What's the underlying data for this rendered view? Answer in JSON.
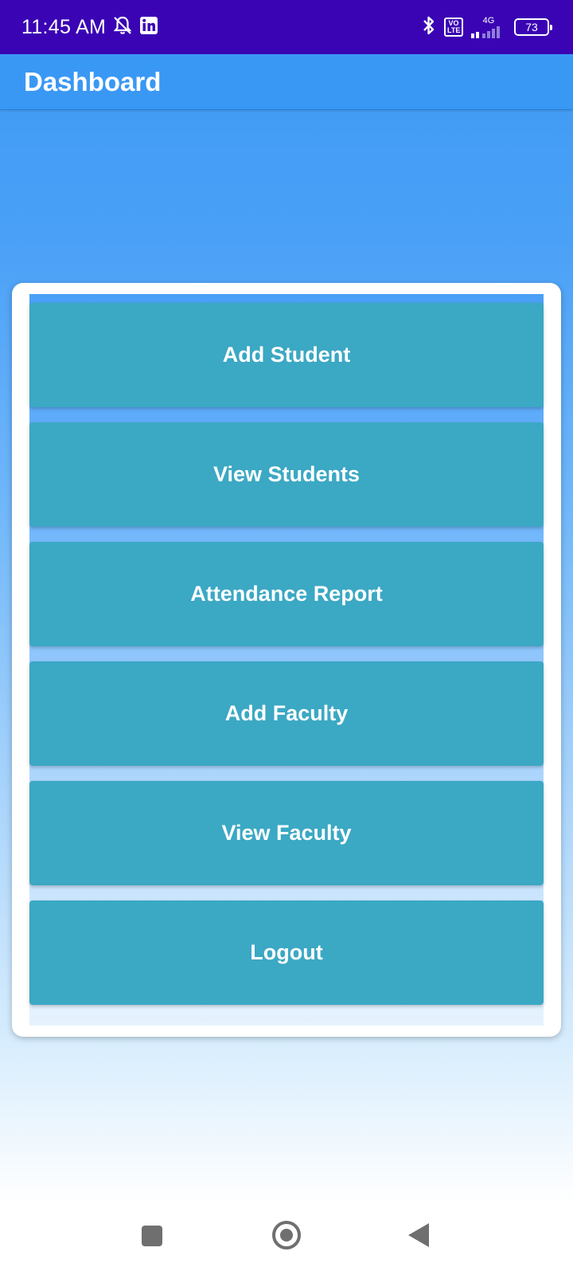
{
  "status_bar": {
    "time": "11:45 AM",
    "icons": [
      "notifications-off-icon",
      "linkedin-icon",
      "bluetooth-icon",
      "volte-icon",
      "signal-4g-icon",
      "battery-icon"
    ],
    "volte_label": "Vo\nLTE",
    "network": "4G",
    "battery": "73"
  },
  "app_bar": {
    "title": "Dashboard"
  },
  "menu": {
    "buttons": [
      {
        "label": "Add Student"
      },
      {
        "label": "View Students"
      },
      {
        "label": "Attendance Report"
      },
      {
        "label": "Add Faculty"
      },
      {
        "label": "View Faculty"
      },
      {
        "label": "Logout"
      }
    ]
  },
  "nav_bar": {
    "icons": [
      "recents-icon",
      "home-icon",
      "back-icon"
    ]
  },
  "colors": {
    "status_bar": "#3a04b4",
    "app_bar": "#3a98f5",
    "button": "#3ba8c4",
    "nav_icon": "#6f6f6f"
  }
}
